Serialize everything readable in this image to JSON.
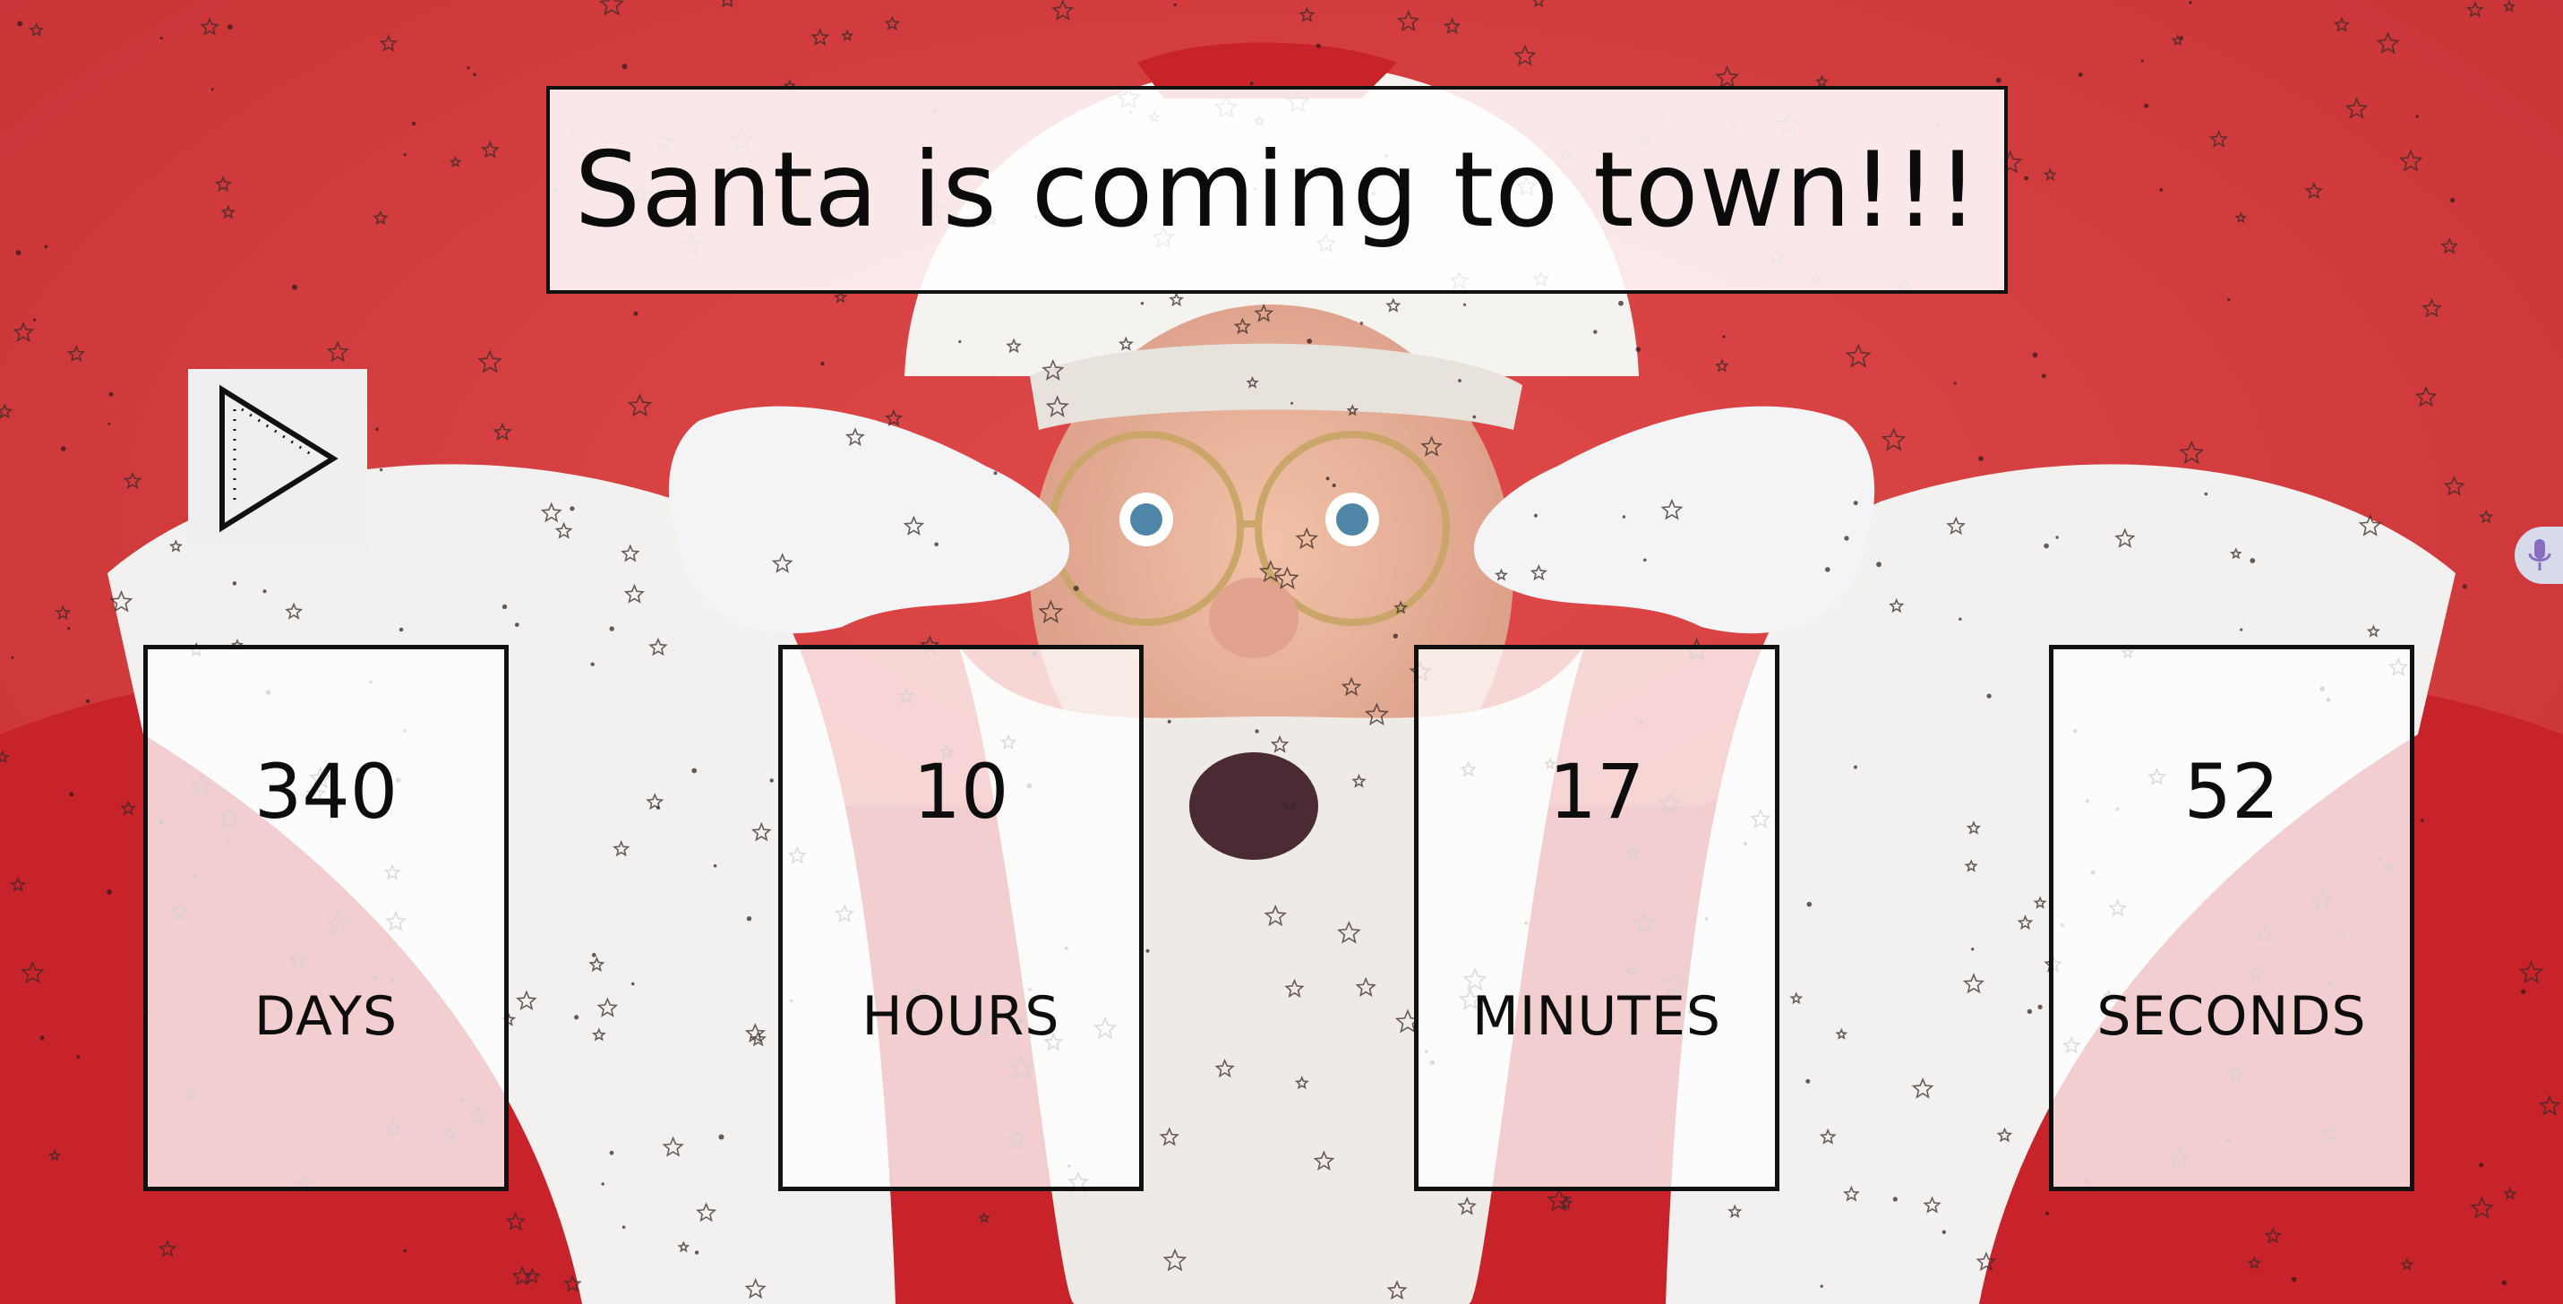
{
  "header": {
    "title": "Santa is coming to town!!!"
  },
  "countdown": [
    {
      "value": "340",
      "label": "DAYS"
    },
    {
      "value": "10",
      "label": "HOURS"
    },
    {
      "value": "17",
      "label": "MINUTES"
    },
    {
      "value": "52",
      "label": "SECONDS"
    }
  ],
  "controls": {
    "play_icon": "play-icon",
    "mic_icon": "microphone-icon"
  },
  "colors": {
    "background_red": "#d63b3c",
    "suit_red": "#c8232b",
    "fur_white": "#f3f1ef",
    "box_border": "#111111",
    "mic_accent": "#8a6cc0"
  }
}
